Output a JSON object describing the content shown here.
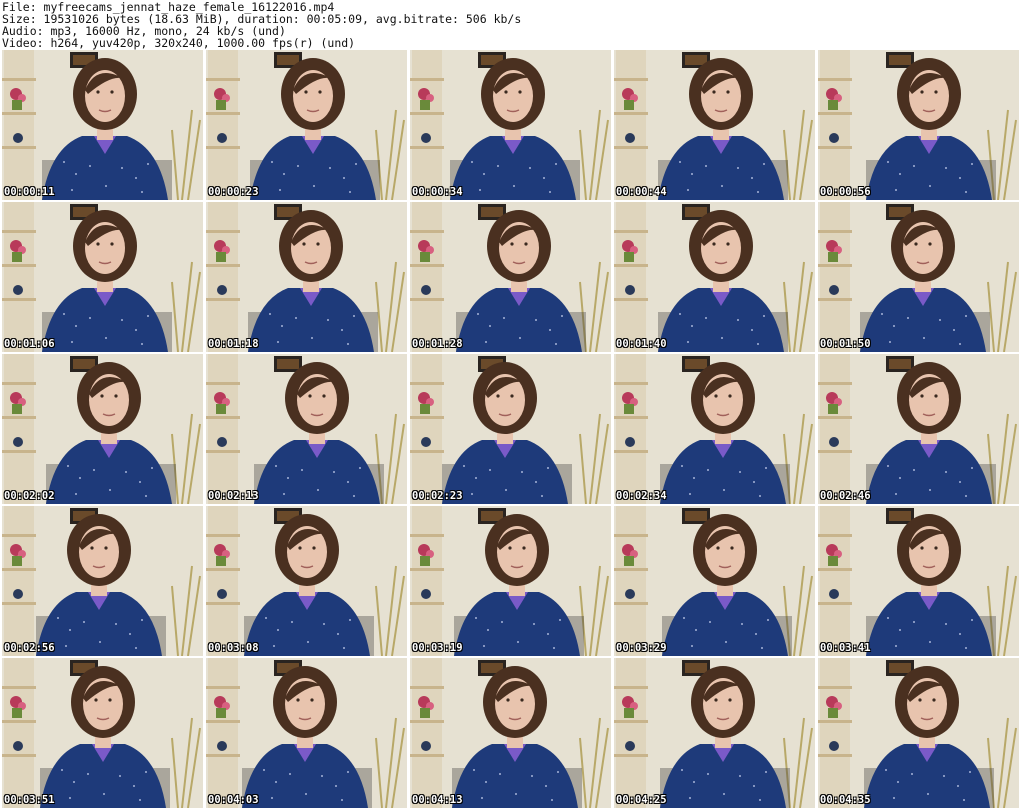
{
  "header": {
    "file": "File: myfreecams_jennat_haze_female_16122016.mp4",
    "size": "Size: 19531026 bytes (18.63 MiB), duration: 00:05:09, avg.bitrate: 506 kb/s",
    "audio": "Audio: mp3, 16000 Hz, mono, 24 kb/s (und)",
    "video": "Video: h264, yuv420p, 320x240, 1000.00 fps(r) (und)"
  },
  "colors": {
    "wall": "#e6e1d2",
    "shirt": "#1e3a7a",
    "hair": "#4a3020",
    "skin": "#e8c4ae",
    "shelf": "#d8c9a8",
    "frame": "#2a2420",
    "flowers": "#b83a5a",
    "timestamp": "#ffffff"
  },
  "thumbnails": [
    {
      "time": "00:00:11"
    },
    {
      "time": "00:00:23"
    },
    {
      "time": "00:00:34"
    },
    {
      "time": "00:00:44"
    },
    {
      "time": "00:00:56"
    },
    {
      "time": "00:01:06"
    },
    {
      "time": "00:01:18"
    },
    {
      "time": "00:01:28"
    },
    {
      "time": "00:01:40"
    },
    {
      "time": "00:01:50"
    },
    {
      "time": "00:02:02"
    },
    {
      "time": "00:02:13"
    },
    {
      "time": "00:02:23"
    },
    {
      "time": "00:02:34"
    },
    {
      "time": "00:02:46"
    },
    {
      "time": "00:02:56"
    },
    {
      "time": "00:03:08"
    },
    {
      "time": "00:03:19"
    },
    {
      "time": "00:03:29"
    },
    {
      "time": "00:03:41"
    },
    {
      "time": "00:03:51"
    },
    {
      "time": "00:04:03"
    },
    {
      "time": "00:04:13"
    },
    {
      "time": "00:04:25"
    },
    {
      "time": "00:04:35"
    }
  ]
}
